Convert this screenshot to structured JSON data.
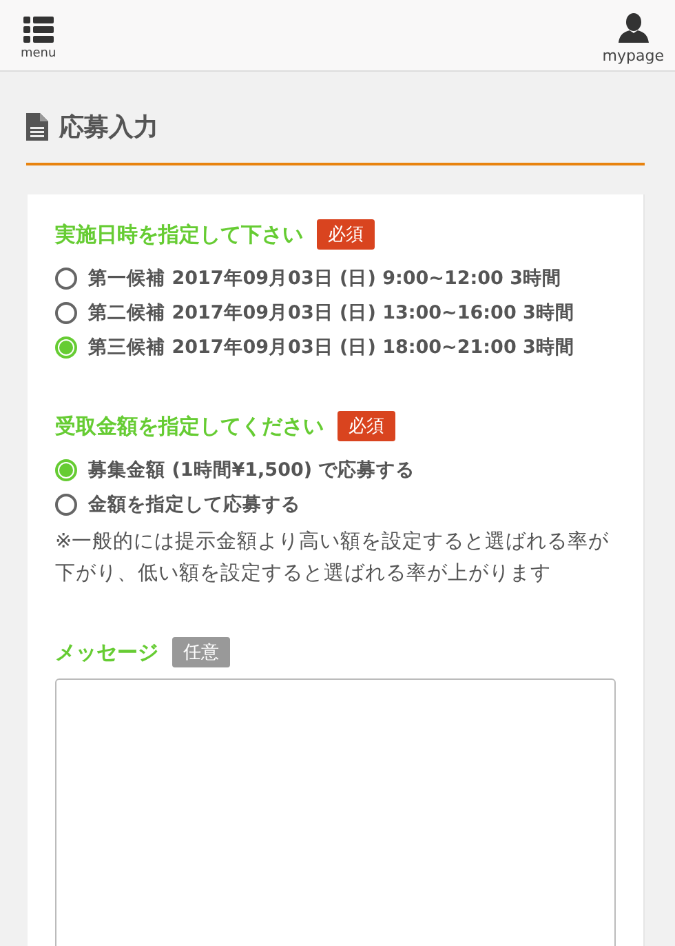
{
  "header": {
    "menu_label": "menu",
    "mypage_label": "mypage"
  },
  "page_title": "応募入力",
  "sections": [
    {
      "kind": "radio",
      "label": "実施日時を指定して下さい",
      "badge": {
        "kind": "required",
        "text": "必須"
      },
      "options": [
        {
          "label": "第一候補  2017年09月03日 (日) 9:00~12:00 3時間",
          "selected": false
        },
        {
          "label": "第二候補  2017年09月03日 (日) 13:00~16:00 3時間",
          "selected": false
        },
        {
          "label": "第三候補  2017年09月03日 (日) 18:00~21:00 3時間",
          "selected": true
        }
      ]
    },
    {
      "kind": "radio",
      "label": "受取金額を指定してください",
      "badge": {
        "kind": "required",
        "text": "必須"
      },
      "options": [
        {
          "label": "募集金額 (1時間¥1,500) で応募する",
          "selected": true
        },
        {
          "label": "金額を指定して応募する",
          "selected": false
        }
      ],
      "note": "※一般的には提示金額より高い額を設定すると選ばれる率が下がり、低い額を設定すると選ばれる率が上がります"
    },
    {
      "kind": "textarea",
      "label": "メッセージ",
      "badge": {
        "kind": "optional",
        "text": "任意"
      }
    }
  ]
}
